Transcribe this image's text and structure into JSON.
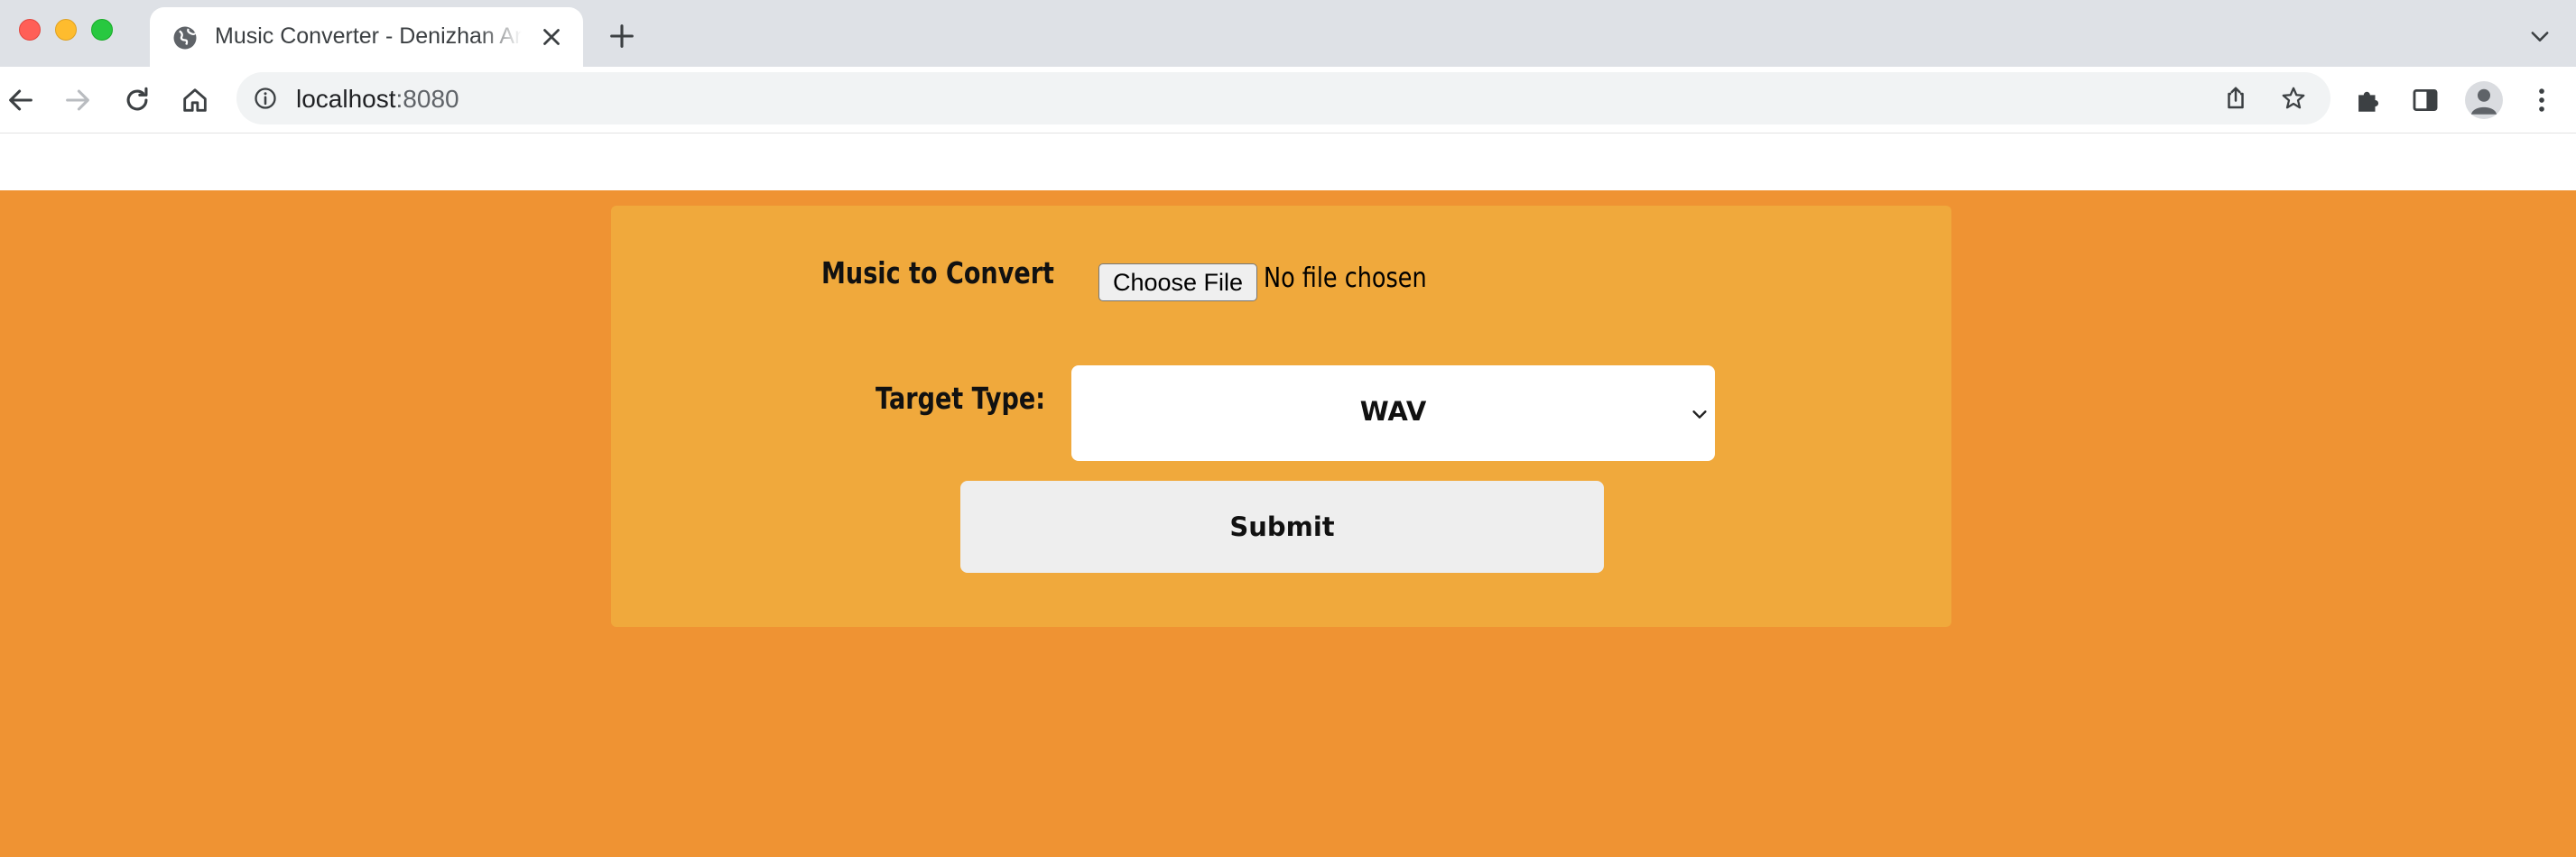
{
  "browser": {
    "tab": {
      "title": "Music Converter - Denizhan Arslan",
      "favicon": "globe-icon"
    },
    "address_bar": {
      "host": "localhost",
      "port": ":8080"
    },
    "icons": [
      "back-icon",
      "forward-icon",
      "reload-icon",
      "home-icon",
      "site-info-icon",
      "share-icon",
      "bookmark-star-icon",
      "extensions-icon",
      "side-panel-icon",
      "profile-icon",
      "menu-icon",
      "new-tab-icon",
      "tab-search-icon",
      "close-icon"
    ]
  },
  "form": {
    "music_label": "Music to Convert",
    "choose_file_label": "Choose File",
    "file_status": "No file chosen",
    "target_label": "Target Type:",
    "target_value": "WAV",
    "submit_label": "Submit"
  },
  "colors": {
    "page_background": "#ef9333",
    "panel_background": "#f0a93c",
    "button_background": "#eeeeee",
    "tabbar_background": "#dee1e6"
  }
}
